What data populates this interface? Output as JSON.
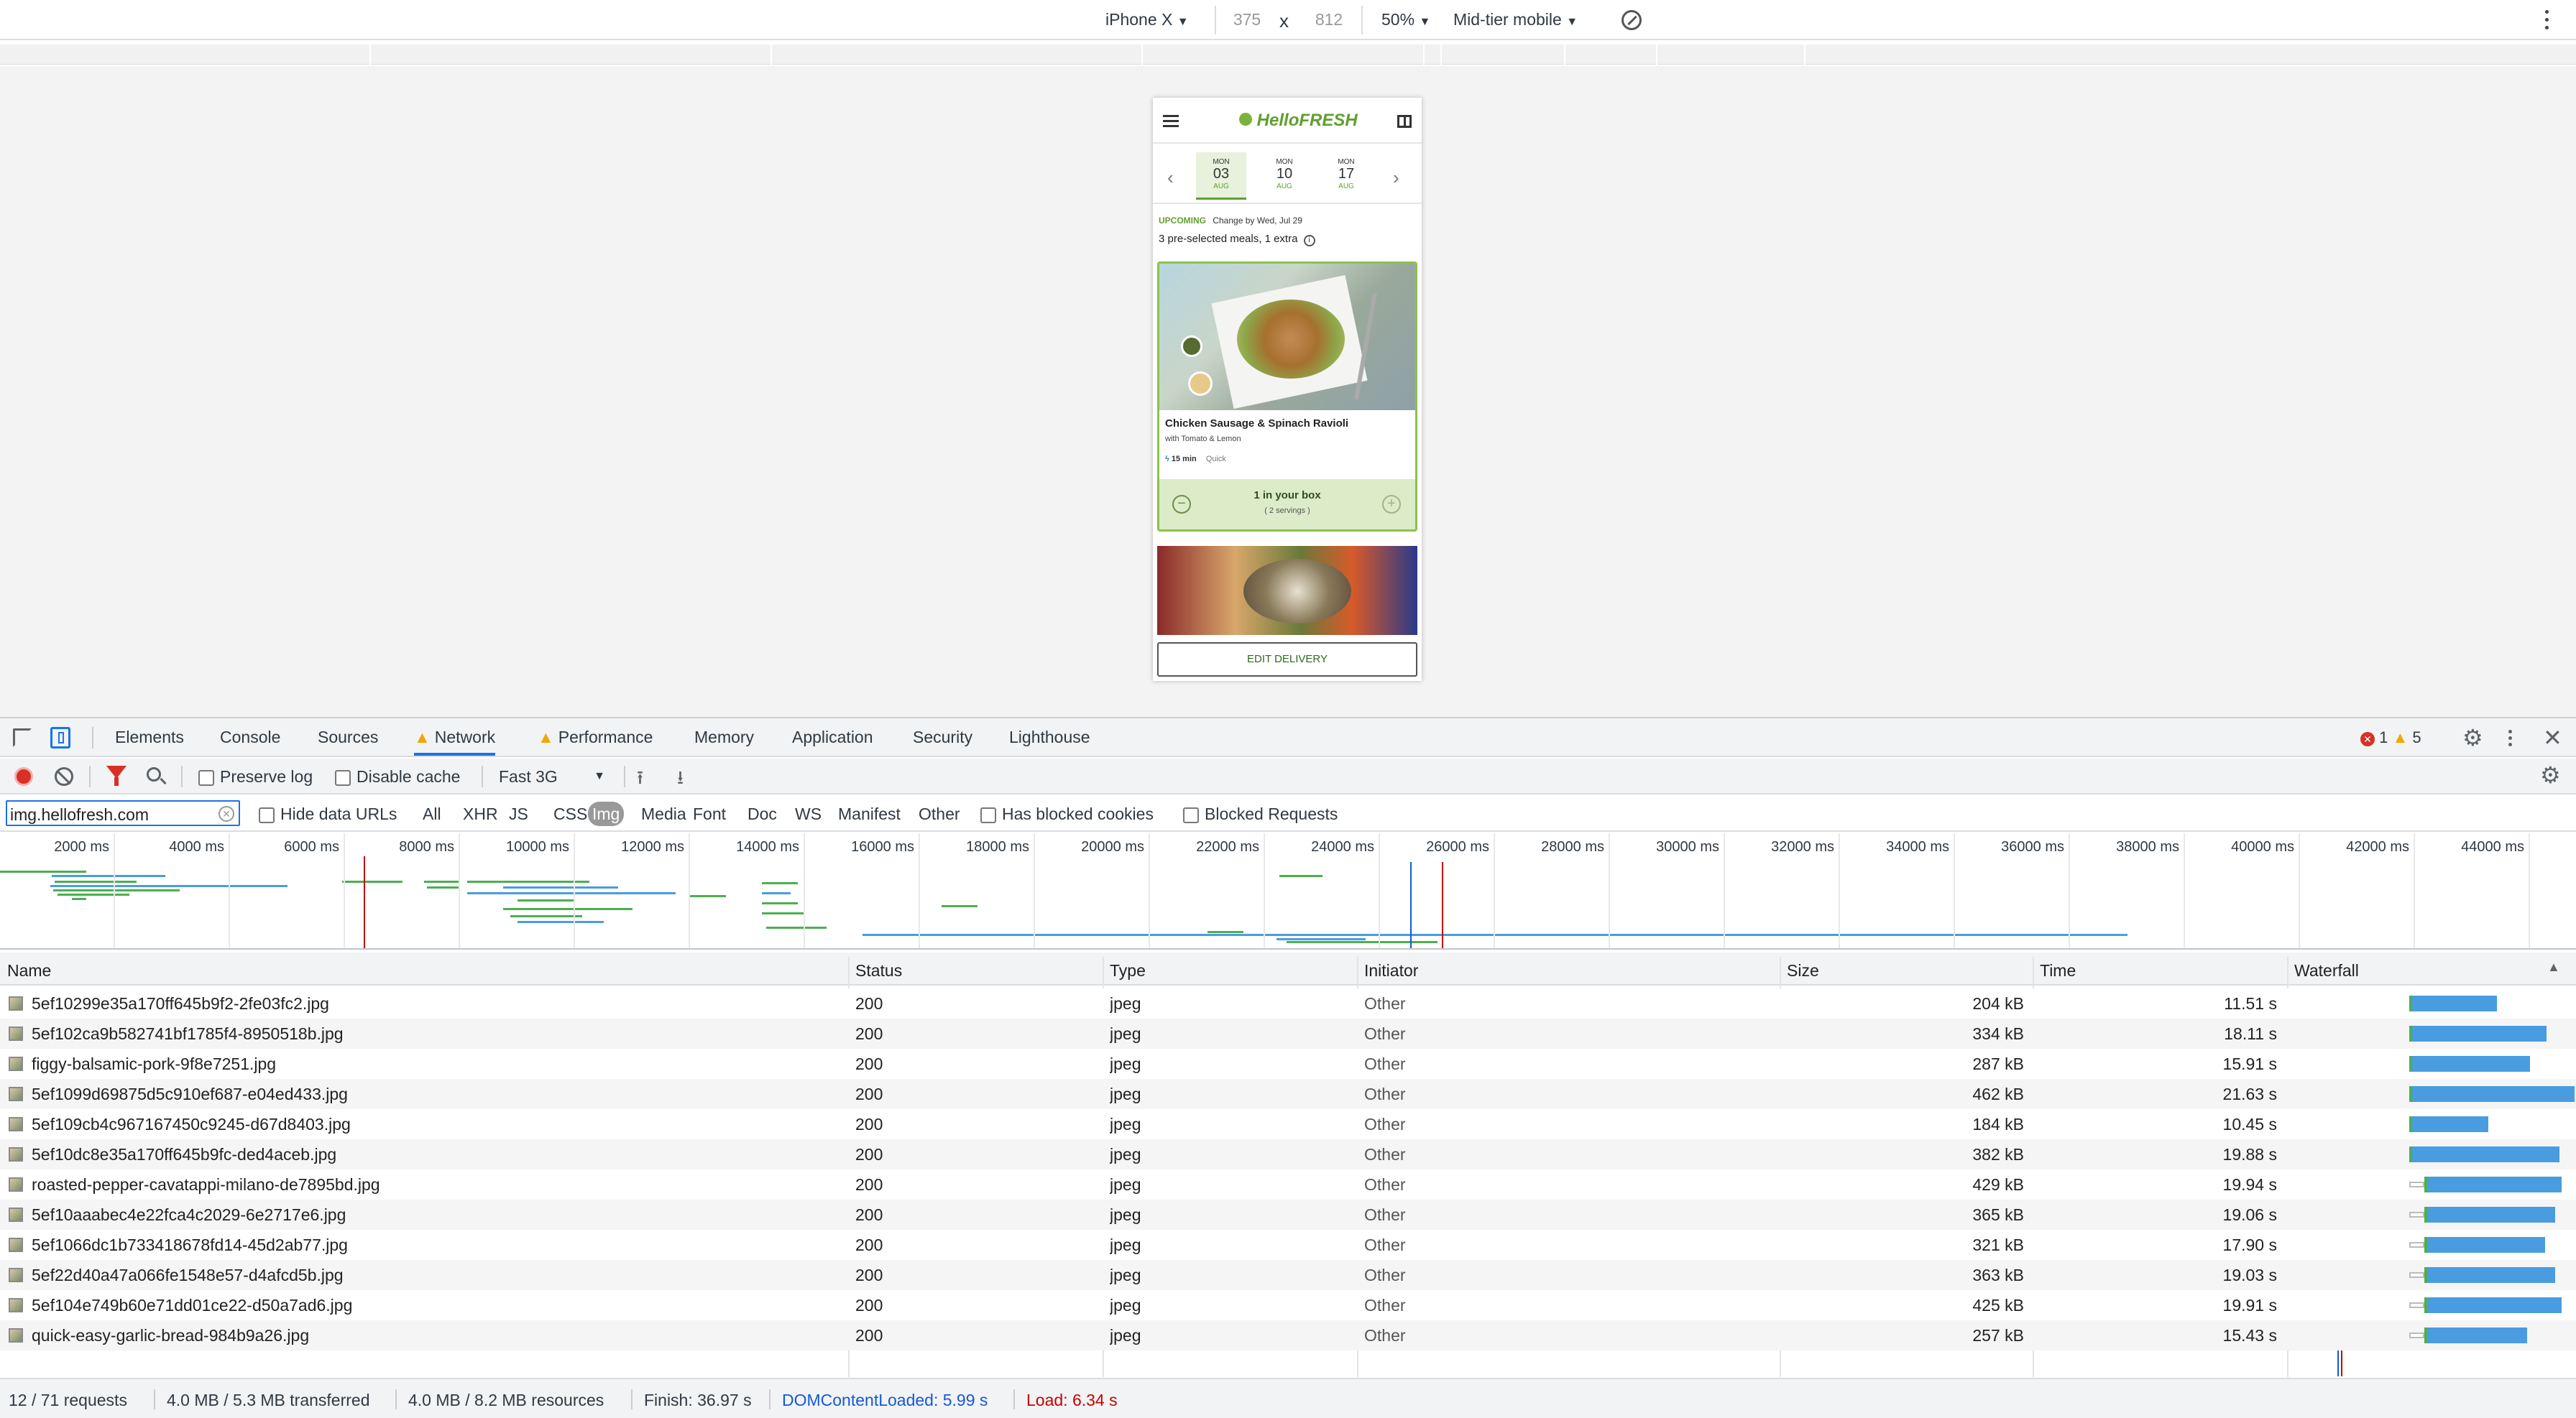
{
  "device_toolbar": {
    "device": "iPhone X",
    "width": "375",
    "height": "812",
    "zoom": "50%",
    "throttle": "Mid-tier mobile",
    "times": "x"
  },
  "phone": {
    "brand": "HelloFRESH",
    "dates": [
      {
        "dow": "MON",
        "day": "03",
        "mon": "AUG"
      },
      {
        "dow": "MON",
        "day": "10",
        "mon": "AUG"
      },
      {
        "dow": "MON",
        "day": "17",
        "mon": "AUG"
      }
    ],
    "upcoming": "UPCOMING",
    "change_by": "Change by Wed, Jul 29",
    "summary": "3 pre-selected meals, 1 extra",
    "meal_title": "Chicken Sausage & Spinach Ravioli",
    "meal_sub": "with Tomato & Lemon",
    "meal_time": "15 min",
    "meal_tag": "Quick",
    "box_count": "1 in your box",
    "box_servings": "( 2 servings )",
    "edit_btn": "EDIT DELIVERY"
  },
  "devtools": {
    "tabs": [
      "Elements",
      "Console",
      "Sources",
      "Network",
      "Performance",
      "Memory",
      "Application",
      "Security",
      "Lighthouse"
    ],
    "active_tab": "Network",
    "errors": "1",
    "warnings": "5",
    "preserve_log": "Preserve log",
    "disable_cache": "Disable cache",
    "throttling": "Fast 3G",
    "filter_value": "img.hellofresh.com",
    "hide_data_urls": "Hide data URLs",
    "types": [
      "All",
      "XHR",
      "JS",
      "CSS",
      "Img",
      "Media",
      "Font",
      "Doc",
      "WS",
      "Manifest",
      "Other"
    ],
    "active_type": "Img",
    "has_blocked_cookies": "Has blocked cookies",
    "blocked_requests": "Blocked Requests",
    "timeline_ticks": [
      "2000 ms",
      "4000 ms",
      "6000 ms",
      "8000 ms",
      "10000 ms",
      "12000 ms",
      "14000 ms",
      "16000 ms",
      "18000 ms",
      "20000 ms",
      "22000 ms",
      "24000 ms",
      "26000 ms",
      "28000 ms",
      "30000 ms",
      "32000 ms",
      "34000 ms",
      "36000 ms",
      "38000 ms",
      "40000 ms",
      "42000 ms",
      "44000 ms"
    ],
    "columns": [
      "Name",
      "Status",
      "Type",
      "Initiator",
      "Size",
      "Time",
      "Waterfall"
    ],
    "rows": [
      {
        "name": "5ef10299e35a170ff645b9f2-2fe03fc2.jpg",
        "status": "200",
        "type": "jpeg",
        "initiator": "Other",
        "size": "204 kB",
        "time": "11.51 s",
        "wf": [
          0.0,
          0.0,
          0.53
        ]
      },
      {
        "name": "5ef102ca9b582741bf1785f4-8950518b.jpg",
        "status": "200",
        "type": "jpeg",
        "initiator": "Other",
        "size": "334 kB",
        "time": "18.11 s",
        "wf": [
          0.0,
          0.0,
          0.83
        ]
      },
      {
        "name": "figgy-balsamic-pork-9f8e7251.jpg",
        "status": "200",
        "type": "jpeg",
        "initiator": "Other",
        "size": "287 kB",
        "time": "15.91 s",
        "wf": [
          0.0,
          0.0,
          0.73
        ]
      },
      {
        "name": "5ef1099d69875d5c910ef687-e04ed433.jpg",
        "status": "200",
        "type": "jpeg",
        "initiator": "Other",
        "size": "462 kB",
        "time": "21.63 s",
        "wf": [
          0.0,
          0.0,
          1.0
        ]
      },
      {
        "name": "5ef109cb4c967167450c9245-d67d8403.jpg",
        "status": "200",
        "type": "jpeg",
        "initiator": "Other",
        "size": "184 kB",
        "time": "10.45 s",
        "wf": [
          0.0,
          0.0,
          0.48
        ]
      },
      {
        "name": "5ef10dc8e35a170ff645b9fc-ded4aceb.jpg",
        "status": "200",
        "type": "jpeg",
        "initiator": "Other",
        "size": "382 kB",
        "time": "19.88 s",
        "wf": [
          0.0,
          0.0,
          0.91
        ]
      },
      {
        "name": "roasted-pepper-cavatappi-milano-de7895bd.jpg",
        "status": "200",
        "type": "jpeg",
        "initiator": "Other",
        "size": "429 kB",
        "time": "19.94 s",
        "wf": [
          0.09,
          0.09,
          0.92
        ]
      },
      {
        "name": "5ef10aaabec4e22fca4c2029-6e2717e6.jpg",
        "status": "200",
        "type": "jpeg",
        "initiator": "Other",
        "size": "365 kB",
        "time": "19.06 s",
        "wf": [
          0.09,
          0.09,
          0.88
        ]
      },
      {
        "name": "5ef1066dc1b733418678fd14-45d2ab77.jpg",
        "status": "200",
        "type": "jpeg",
        "initiator": "Other",
        "size": "321 kB",
        "time": "17.90 s",
        "wf": [
          0.09,
          0.09,
          0.82
        ]
      },
      {
        "name": "5ef22d40a47a066fe1548e57-d4afcd5b.jpg",
        "status": "200",
        "type": "jpeg",
        "initiator": "Other",
        "size": "363 kB",
        "time": "19.03 s",
        "wf": [
          0.09,
          0.09,
          0.88
        ]
      },
      {
        "name": "5ef104e749b60e71dd01ce22-d50a7ad6.jpg",
        "status": "200",
        "type": "jpeg",
        "initiator": "Other",
        "size": "425 kB",
        "time": "19.91 s",
        "wf": [
          0.09,
          0.09,
          0.92
        ]
      },
      {
        "name": "quick-easy-garlic-bread-984b9a26.jpg",
        "status": "200",
        "type": "jpeg",
        "initiator": "Other",
        "size": "257 kB",
        "time": "15.43 s",
        "wf": [
          0.09,
          0.09,
          0.71
        ]
      }
    ],
    "status_bar": {
      "requests": "12 / 71 requests",
      "transferred": "4.0 MB / 5.3 MB transferred",
      "resources": "4.0 MB / 8.2 MB resources",
      "finish": "Finish: 36.97 s",
      "dcl": "DOMContentLoaded: 5.99 s",
      "load": "Load: 6.34 s"
    }
  },
  "colors": {
    "accent": "#1a73e8",
    "dcl": "#1558d6",
    "load": "#c80000",
    "green_brand": "#5f9f2f",
    "bar_green": "#4caf50",
    "bar_blue": "#4a9ce0"
  }
}
